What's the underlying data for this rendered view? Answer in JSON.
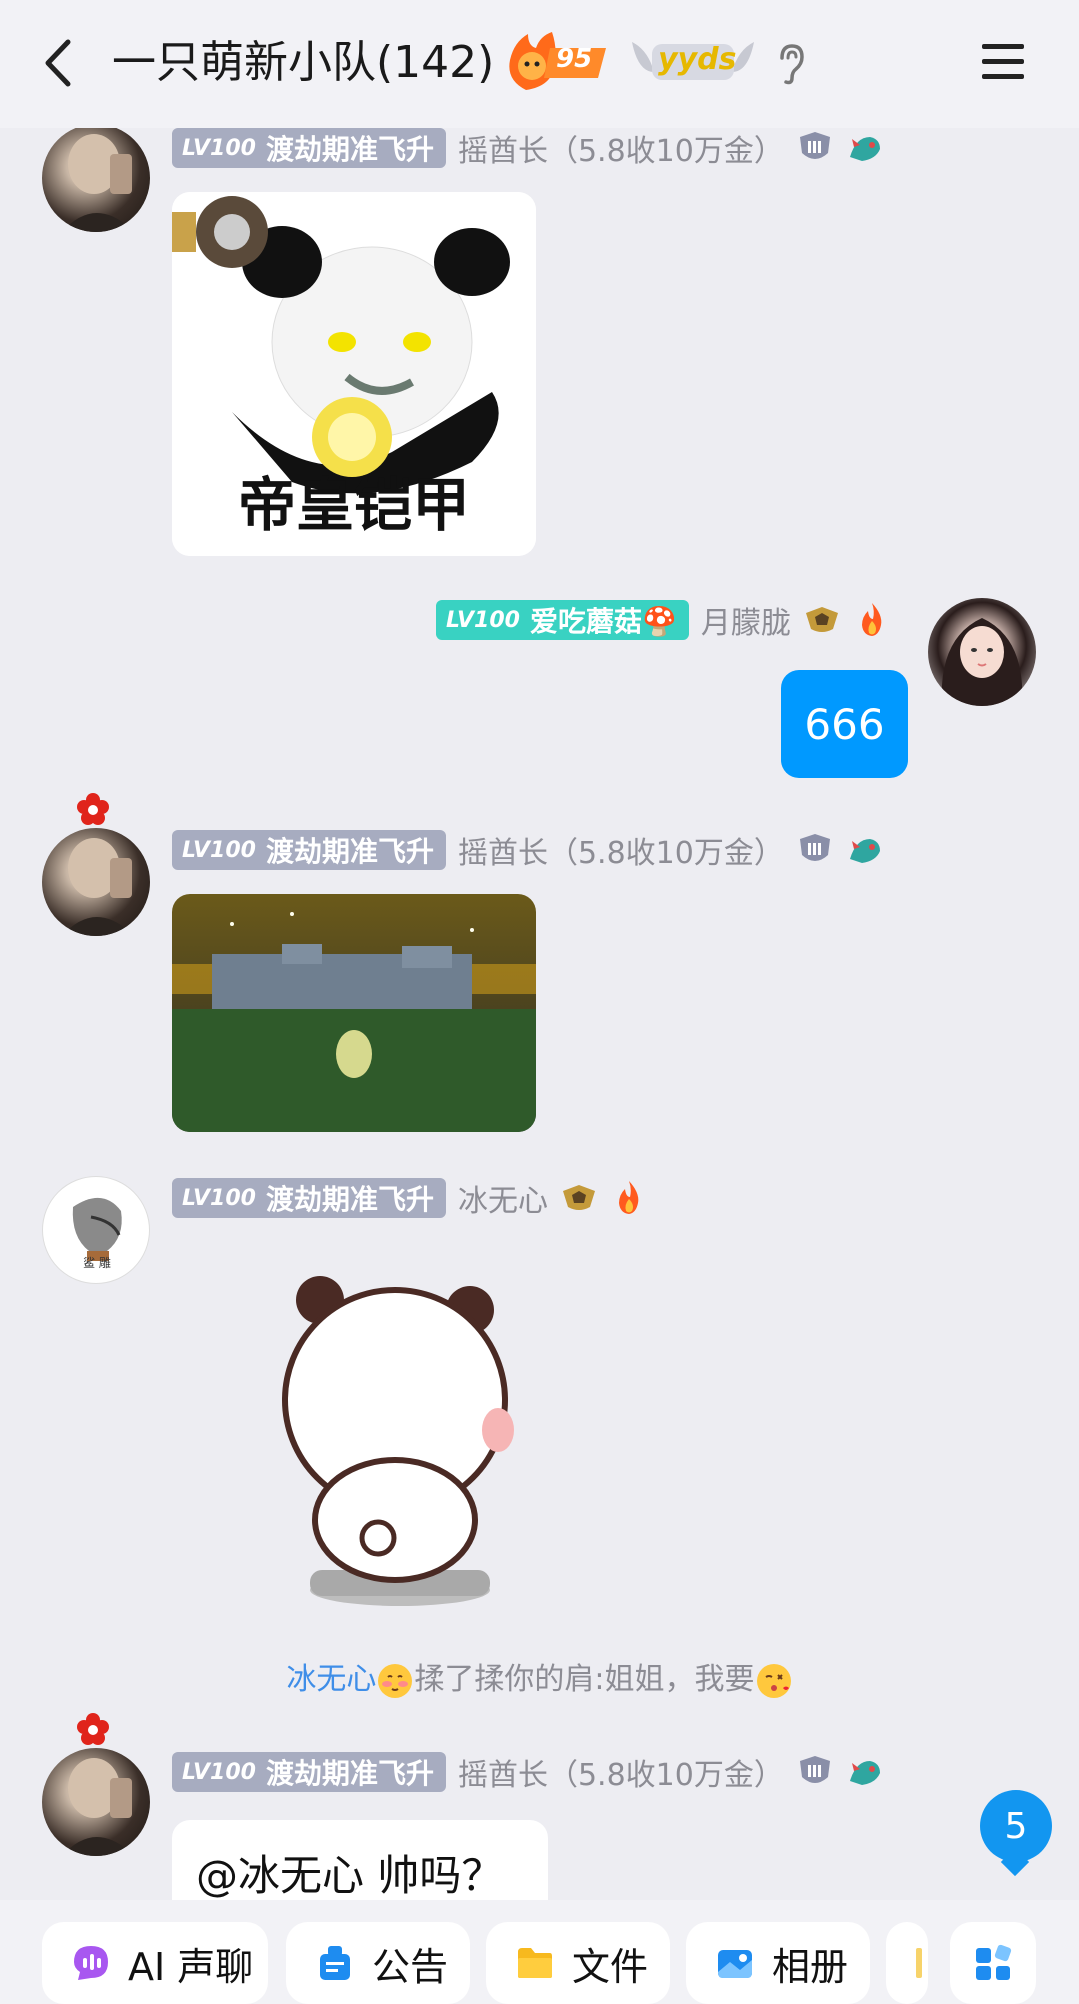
{
  "header": {
    "title": "一只萌新小队(142)",
    "fire_level": "95",
    "badge_text": "yyds"
  },
  "messages": [
    {
      "level": "LV100",
      "title_badge": "渡劫期准飞升",
      "nickname": "摇酋长（5.8收10万金）",
      "type": "image",
      "caption": "帝皇铠甲"
    },
    {
      "level": "LV100",
      "title_badge": "爱吃蘑菇🍄",
      "nickname": "月朦胧",
      "type": "text",
      "text": "666",
      "self": true
    },
    {
      "level": "LV100",
      "title_badge": "渡劫期准飞升",
      "nickname": "摇酋长（5.8收10万金）",
      "type": "image"
    },
    {
      "level": "LV100",
      "title_badge": "渡劫期准飞升",
      "nickname": "冰无心",
      "type": "sticker",
      "avatar_text": "鲨 雕"
    },
    {
      "level": "LV100",
      "title_badge": "渡劫期准飞升",
      "nickname": "摇酋长（5.8收10万金）",
      "type": "text",
      "text": "@冰无心 帅吗？"
    }
  ],
  "system_notice": {
    "actor": "冰无心",
    "action": "揉了揉你的肩:姐姐，我要"
  },
  "unread_count": "5",
  "toolbar": {
    "items": [
      "AI 声聊",
      "公告",
      "文件",
      "相册"
    ]
  },
  "colors": {
    "accent_blue": "#0099ff",
    "badge_gray": "#a7acc0",
    "badge_teal": "#39d2c2",
    "background": "#ededf2"
  }
}
